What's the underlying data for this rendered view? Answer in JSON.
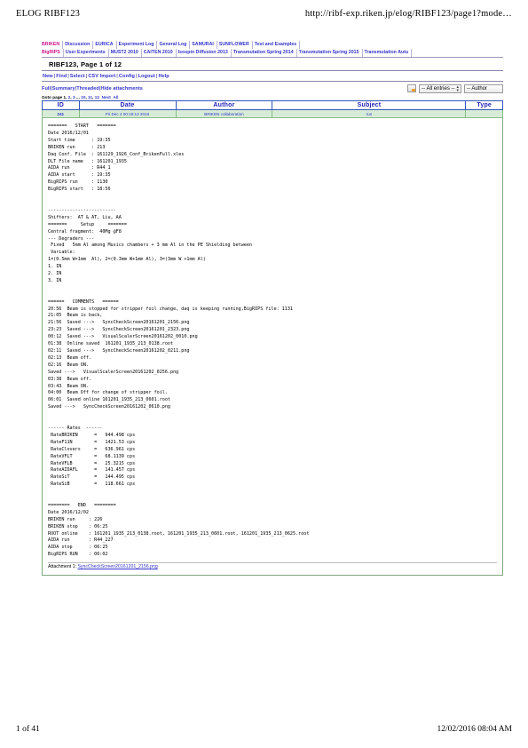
{
  "print_header": {
    "left": "ELOG RIBF123",
    "right": "http://ribf-exp.riken.jp/elog/RIBF123/page1?mode…"
  },
  "print_footer": {
    "left": "1 of 41",
    "right": "12/02/2016 08:04 AM"
  },
  "tabs_row1": [
    {
      "label": "BRIKEN",
      "active": true
    },
    {
      "label": "Discussion",
      "active": false
    },
    {
      "label": "EURICA",
      "active": false
    },
    {
      "label": "Experiment Log",
      "active": false
    },
    {
      "label": "General Log",
      "active": false
    },
    {
      "label": "SAMURAI",
      "active": false
    },
    {
      "label": "SUNFLOWER",
      "active": false
    },
    {
      "label": "Test and Examples",
      "active": false
    }
  ],
  "tabs_row2": [
    {
      "label": "BigRIPS",
      "active": true
    },
    {
      "label": "User Experiments",
      "active": false
    },
    {
      "label": "MUST2 2010",
      "active": false
    },
    {
      "label": "CAITEN 2010",
      "active": false
    },
    {
      "label": "Isospin Diffusion 2013",
      "active": false
    },
    {
      "label": "Transmutation Spring 2014",
      "active": false
    },
    {
      "label": "Transmutation Spring 2015",
      "active": false
    },
    {
      "label": "Transmutation Autu",
      "active": false
    }
  ],
  "page_title": "RIBF123, Page 1 of 12",
  "commands": [
    "New",
    "Find",
    "Select",
    "CSV Import",
    "Config",
    "Logout",
    "Help"
  ],
  "view_modes": [
    "Full",
    "Summary",
    "Threaded",
    "Hide attachments"
  ],
  "filters": {
    "entries_select": "-- All entries --",
    "author_select": "-- Author"
  },
  "goto": {
    "label": "Goto page",
    "current": "1",
    "pages": [
      "2",
      "3"
    ],
    "ellipsis": "...",
    "tail_pages": [
      "10",
      "11",
      "12"
    ],
    "next": "Next",
    "all": "All"
  },
  "table": {
    "headers": [
      "ID",
      "Date",
      "Author",
      "Subject",
      "Type"
    ],
    "rows": [
      {
        "id": "241",
        "date": "Fri Dec 2 00:16:13 2016",
        "author": "BRIKEN collaboration",
        "subject": "run",
        "type": ""
      }
    ]
  },
  "log_text": "=======   START   =======\nDate 2016/12/01\nStart time      : 19:35\nBRIKEN run      : 213\nDaq Conf. File  : 161129_1926_Conf_BrikenFull.xles\nDLT File name   : 161201_1935\nAIDA run        : R44_1\nAIDA start      : 19:35\nBigRIPS run     : 1130\nBigRIPS start   : 18:56\n\n\n-------------------------\nShifters:  AT & AT, Liu, AA\n=======     Setup     =======\nCentral fragment:  40Mg @F8\n--- Degraders ---\n Fixed   5mm Al among Musics chambers + 3 mm Al in the PE Shielding between\n Variable:\n1=(0.5mm W+1mm  Al), 2=(0.3mm W+1mm Al), 3=(3mm W +1mm Al)\n1. IN\n2. IN\n3. IN\n\n\n======   COMMENTS   ======\n20:56  Beam is stopped for stripper foil change, daq is keeping running,BigRIPS file: 1131\n21:05  Beam is back,\n21:56  Saved --->   SyncCheckScreen20161201_2156.png\n23:23  Saved --->   SyncCheckScreen20161201_2323.png\n00:12  Saved --->   VisualScalerScreen20161202_0010.png\n01:38  Online saved  161201_1935_213_0138.root\n02:11  Saved --->   SyncCheckScreen20161202_0211.png\n02:13  Beam off.\n02:16  Beam ON.\nSaved --->   VisualScalerScreen20161202_0256.png\n03:38  Beam off.\n03:43  Beam ON.\n04:00  Beam Off for change of stripper foil.\n06:01  Saved online 161201_1935_213_0601.root\nSaved --->   SyncCheckScreen20161202_0610.png\n\n\n------ Rates  ------\n RateBRIKEN      =   944.498 cps\n RateF11N        =   1421.53 cps\n RateClovers     =   636.961 cps\n RateVFLT        =   68.1139 cps\n RateVFLB        =   25.3215 cps\n RateAIDAFL      =   141.457 cps\n RateSiT         =   144.495 cps\n RateSiB         =   118.661 cps\n\n\n========   END   ========\nDate 2016/12/02\nBRIKEN run     : 226\nBRIKEN stop    : 06:25\nROOT online    : 161201_1935_213_0138.root, 161201_1935_213_0601.root, 161201_1935_213_0625.root\nAIDA run       : R44_227\nAIDA stop      : 06:25\nBigRIPS RUN    : 06:02",
  "attachment": {
    "label": "Attachment 1:",
    "file": "SyncCheckScreen20161201_2156.png"
  }
}
